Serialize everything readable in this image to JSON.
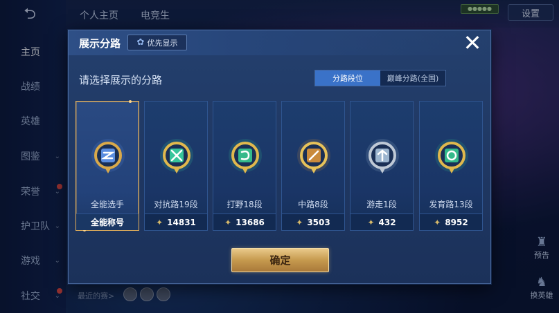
{
  "background": {
    "sidebar": {
      "back_symbol": "⮌",
      "items": [
        {
          "label": "主页",
          "active": true,
          "chevron": false,
          "dot": false
        },
        {
          "label": "战绩",
          "active": false,
          "chevron": false,
          "dot": false
        },
        {
          "label": "英雄",
          "active": false,
          "chevron": false,
          "dot": false
        },
        {
          "label": "图鉴",
          "active": false,
          "chevron": true,
          "dot": false
        },
        {
          "label": "荣誉",
          "active": false,
          "chevron": true,
          "dot": true
        },
        {
          "label": "护卫队",
          "active": false,
          "chevron": true,
          "dot": false
        },
        {
          "label": "游戏",
          "active": false,
          "chevron": true,
          "dot": false
        },
        {
          "label": "社交",
          "active": false,
          "chevron": true,
          "dot": true
        }
      ]
    },
    "top_tabs": [
      "个人主页",
      "电竞生"
    ],
    "settings_label": "设置",
    "status_chip": "●●●●●",
    "right_icons": [
      {
        "icon": "trophy-icon",
        "label": "预告"
      },
      {
        "icon": "hero-icon",
        "label": "换英雄"
      }
    ],
    "recent_label": "最近的赛>"
  },
  "dialog": {
    "title": "展示分路",
    "priority_label": "优先显示",
    "subtitle": "请选择展示的分路",
    "tabs": [
      {
        "label": "分路段位",
        "active": true
      },
      {
        "label": "巅峰分路(全国)",
        "active": false
      }
    ],
    "cards": [
      {
        "name": "全能选手",
        "value": "全能称号",
        "selected": true,
        "badge_color": "#5a8de0",
        "ring_color": "#d9a94a",
        "show_glove": false
      },
      {
        "name": "对抗路19段",
        "value": "14831",
        "selected": false,
        "badge_color": "#37c59b",
        "ring_color": "#e0b84d",
        "show_glove": true
      },
      {
        "name": "打野18段",
        "value": "13686",
        "selected": false,
        "badge_color": "#34b98a",
        "ring_color": "#e0b84d",
        "show_glove": true
      },
      {
        "name": "中路8段",
        "value": "3503",
        "selected": false,
        "badge_color": "#c98a3c",
        "ring_color": "#e7c25a",
        "show_glove": true
      },
      {
        "name": "游走1段",
        "value": "432",
        "selected": false,
        "badge_color": "#9cb5cf",
        "ring_color": "#bfc9d6",
        "show_glove": true
      },
      {
        "name": "发育路13段",
        "value": "8952",
        "selected": false,
        "badge_color": "#34b98a",
        "ring_color": "#e0b84d",
        "show_glove": true
      }
    ],
    "confirm_label": "确定"
  }
}
